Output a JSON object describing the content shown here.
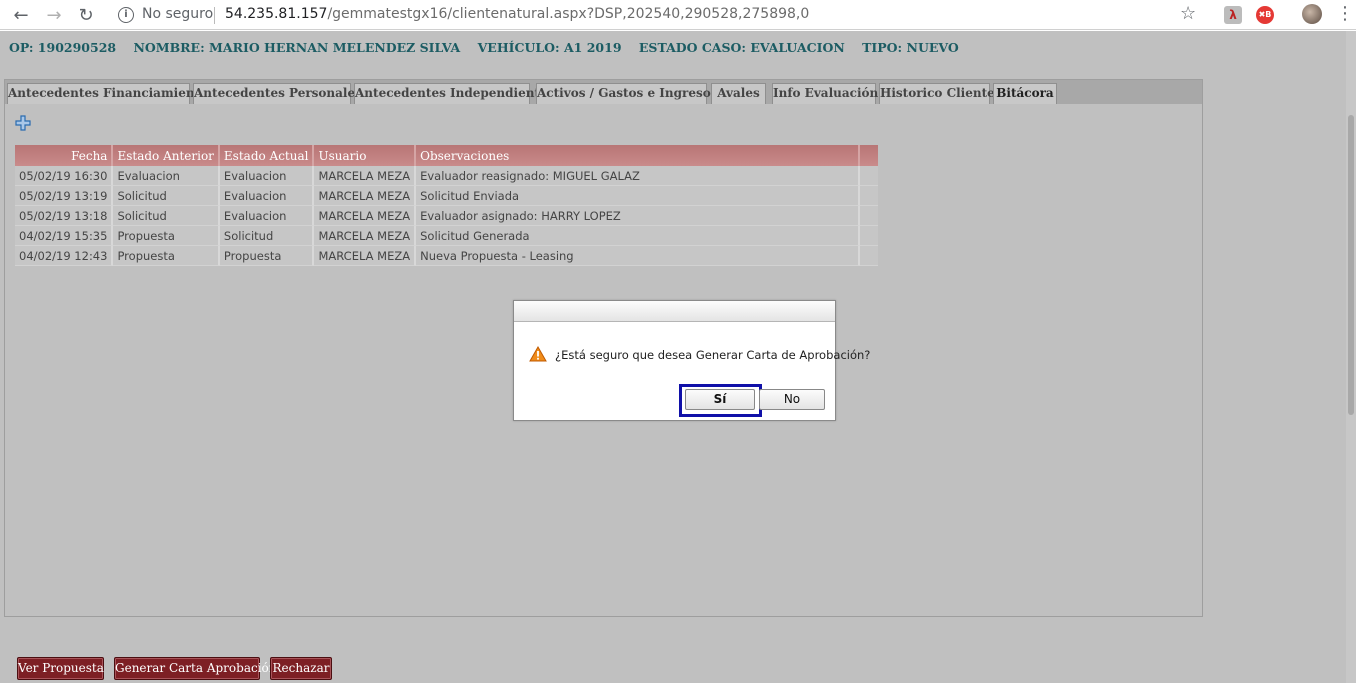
{
  "browser": {
    "security_label": "No seguro",
    "url_host": "54.235.81.157",
    "url_path": "/gemmatestgx16/clientenatural.aspx?DSP,202540,290528,275898,0"
  },
  "header": {
    "op": "OP: 190290528",
    "nombre": "NOMBRE: MARIO HERNAN MELENDEZ SILVA",
    "vehiculo": "VEHÍCULO: A1 2019",
    "estado": "ESTADO CASO: EVALUACION",
    "tipo": "TIPO: NUEVO"
  },
  "tabs": [
    "Antecedentes Financiamiento",
    "Antecedentes Personales",
    "Antecedentes Independiente",
    "Activos / Gastos e Ingresos",
    "Avales",
    "Info Evaluación",
    "Historico Cliente",
    "Bitácora"
  ],
  "active_tab": "Bitácora",
  "grid": {
    "columns": [
      "Fecha",
      "Estado Anterior",
      "Estado Actual",
      "Usuario",
      "Observaciones"
    ],
    "rows": [
      [
        "05/02/19 16:30",
        "Evaluacion",
        "Evaluacion",
        "MARCELA MEZA",
        "Evaluador reasignado: MIGUEL GALAZ"
      ],
      [
        "05/02/19 13:19",
        "Solicitud",
        "Evaluacion",
        "MARCELA MEZA",
        "Solicitud Enviada"
      ],
      [
        "05/02/19 13:18",
        "Solicitud",
        "Evaluacion",
        "MARCELA MEZA",
        "Evaluador asignado: HARRY LOPEZ"
      ],
      [
        "04/02/19 15:35",
        "Propuesta",
        "Solicitud",
        "MARCELA MEZA",
        "Solicitud Generada"
      ],
      [
        "04/02/19 12:43",
        "Propuesta",
        "Propuesta",
        "MARCELA MEZA",
        "Nueva Propuesta - Leasing"
      ]
    ]
  },
  "dialog": {
    "message": "¿Está seguro que desea Generar Carta de Aprobación?",
    "yes_label": "Sí",
    "no_label": "No"
  },
  "actions": {
    "ver_propuesta": "Ver Propuesta",
    "generar_carta": "Generar Carta Aprobación",
    "rechazar": "Rechazar"
  },
  "colors": {
    "header_text": "#1c5c63",
    "grid_header": "#c07f7f",
    "action_button": "#7d1f24",
    "focus_ring": "#1010a8"
  }
}
